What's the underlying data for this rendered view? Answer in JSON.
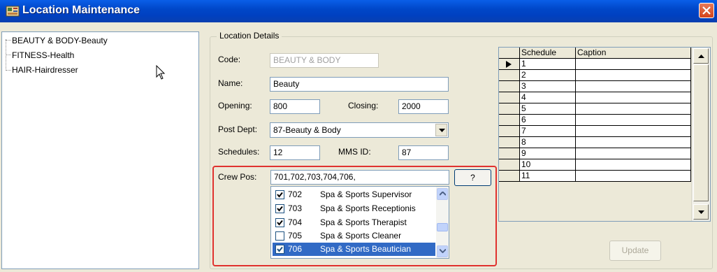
{
  "window": {
    "title": "Location Maintenance"
  },
  "tree": {
    "items": [
      "BEAUTY & BODY-Beauty",
      "FITNESS-Health",
      "HAIR-Hairdresser"
    ]
  },
  "details": {
    "group_title": "Location Details",
    "code": {
      "label": "Code:",
      "value": "BEAUTY & BODY"
    },
    "name": {
      "label": "Name:",
      "value": "Beauty"
    },
    "opening": {
      "label": "Opening:",
      "value": "800"
    },
    "closing": {
      "label": "Closing:",
      "value": "2000"
    },
    "post_dept": {
      "label": "Post Dept:",
      "value": "87-Beauty & Body"
    },
    "schedules": {
      "label": "Schedules:",
      "value": "12"
    },
    "mms_id": {
      "label": "MMS ID:",
      "value": "87"
    },
    "crew_pos": {
      "label": "Crew Pos:",
      "value": "701,702,703,704,706,",
      "help_label": "?"
    }
  },
  "crew_list": [
    {
      "code": "702",
      "name": "Spa & Sports Supervisor",
      "checked": true,
      "selected": false
    },
    {
      "code": "703",
      "name": "Spa & Sports Receptionis",
      "checked": true,
      "selected": false
    },
    {
      "code": "704",
      "name": "Spa & Sports Therapist",
      "checked": true,
      "selected": false
    },
    {
      "code": "705",
      "name": "Spa & Sports Cleaner",
      "checked": false,
      "selected": false
    },
    {
      "code": "706",
      "name": "Spa & Sports Beautician",
      "checked": true,
      "selected": true
    }
  ],
  "schedule_grid": {
    "headers": [
      "Schedule",
      "Caption"
    ],
    "rows": [
      "1",
      "2",
      "3",
      "4",
      "5",
      "6",
      "7",
      "8",
      "9",
      "10",
      "11"
    ],
    "current_row": "1"
  },
  "update_button": {
    "label": "Update"
  },
  "colors": {
    "titlebar": "#0047c9",
    "selection": "#316ac5",
    "highlight_box": "#e0322f"
  }
}
